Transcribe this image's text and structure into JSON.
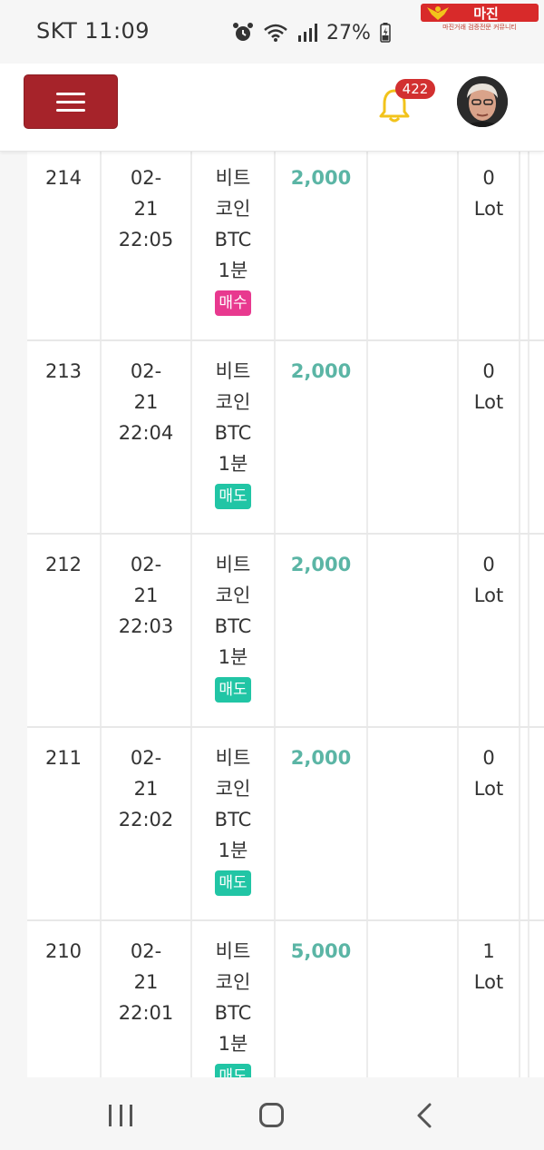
{
  "status": {
    "carrier_time": "SKT 11:09",
    "battery": "27%"
  },
  "watermark": {
    "title": "마진",
    "subtitle": "마진거래 검증전문 커뮤니티"
  },
  "header": {
    "notification_count": "422"
  },
  "rows": [
    {
      "num": "214",
      "date": [
        "02-",
        "21",
        "22:05"
      ],
      "item": [
        "비트",
        "코인",
        "BTC",
        "1분"
      ],
      "side": "매수",
      "side_type": "buy",
      "amount": "2,000",
      "lot": [
        "0",
        "Lot"
      ]
    },
    {
      "num": "213",
      "date": [
        "02-",
        "21",
        "22:04"
      ],
      "item": [
        "비트",
        "코인",
        "BTC",
        "1분"
      ],
      "side": "매도",
      "side_type": "sell",
      "amount": "2,000",
      "lot": [
        "0",
        "Lot"
      ]
    },
    {
      "num": "212",
      "date": [
        "02-",
        "21",
        "22:03"
      ],
      "item": [
        "비트",
        "코인",
        "BTC",
        "1분"
      ],
      "side": "매도",
      "side_type": "sell",
      "amount": "2,000",
      "lot": [
        "0",
        "Lot"
      ]
    },
    {
      "num": "211",
      "date": [
        "02-",
        "21",
        "22:02"
      ],
      "item": [
        "비트",
        "코인",
        "BTC",
        "1분"
      ],
      "side": "매도",
      "side_type": "sell",
      "amount": "2,000",
      "lot": [
        "0",
        "Lot"
      ]
    },
    {
      "num": "210",
      "date": [
        "02-",
        "21",
        "22:01"
      ],
      "item": [
        "비트",
        "코인",
        "BTC",
        "1분"
      ],
      "side": "매도",
      "side_type": "sell",
      "amount": "5,000",
      "lot": [
        "1",
        "Lot"
      ]
    }
  ],
  "colors": {
    "menu_button": "#a6232a",
    "amount": "#5bb5a5",
    "buy_pill": "#e8398f",
    "sell_pill": "#21c5a5",
    "badge": "#d23030",
    "bell": "#f2c31b"
  }
}
